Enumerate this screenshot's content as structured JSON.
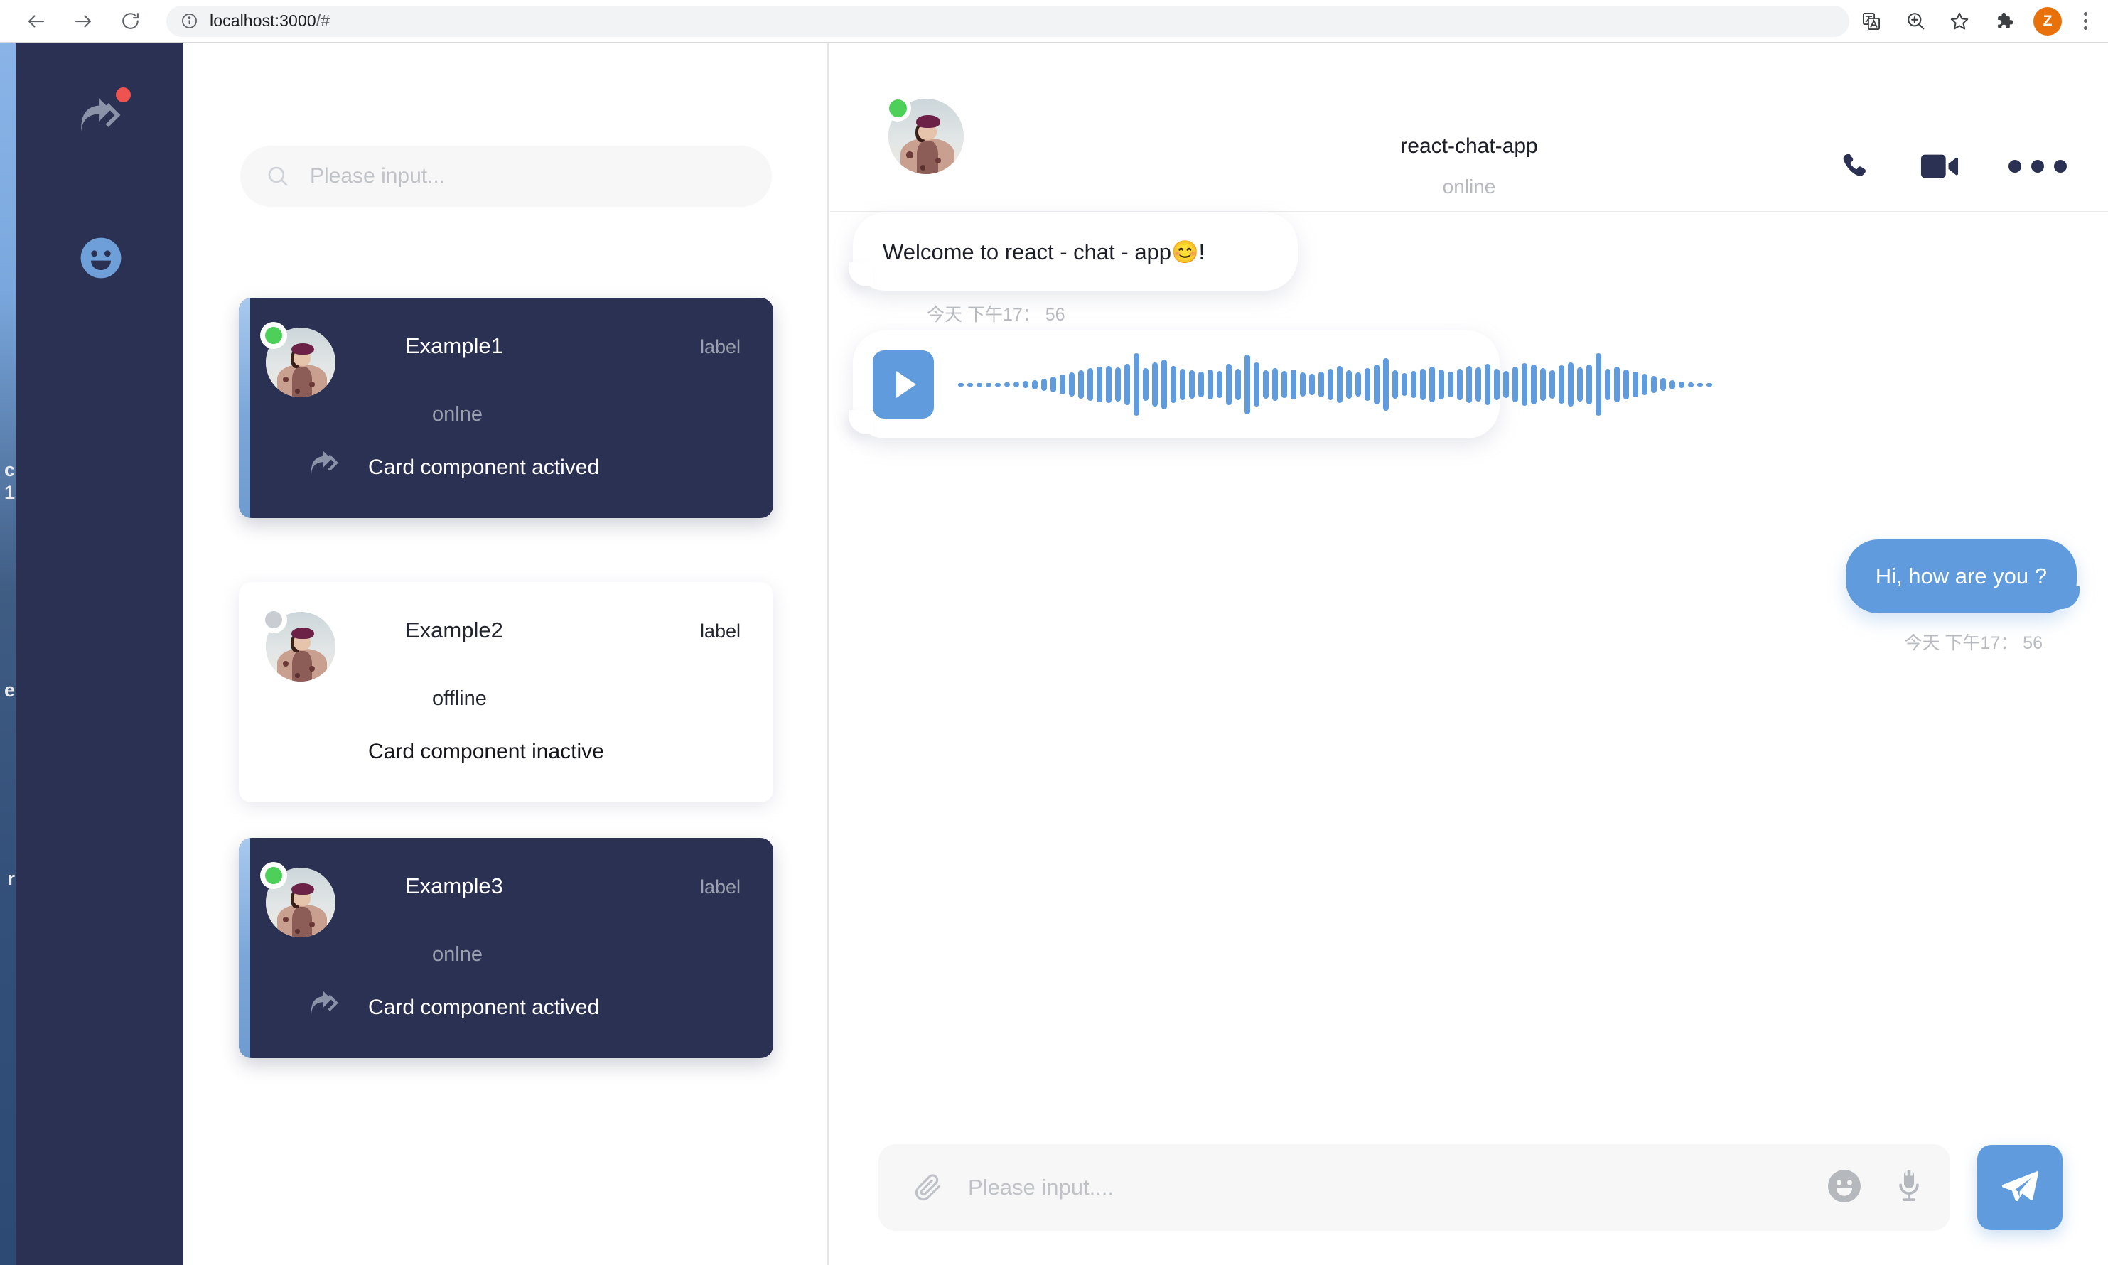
{
  "browser": {
    "url_main": "localhost:3000",
    "url_path": "/#",
    "profile_initial": "Z",
    "icons": [
      "back-icon",
      "forward-icon",
      "reload-icon",
      "page-info-icon",
      "translate-icon",
      "zoom-icon",
      "bookmark-star-icon",
      "extensions-puzzle-icon",
      "profile-avatar",
      "browser-menu-icon"
    ]
  },
  "bleed": {
    "fragments": [
      "c",
      "1",
      "e",
      "r"
    ]
  },
  "rail": {
    "items": [
      {
        "name": "forward-arrow-icon",
        "badge": true
      },
      {
        "name": "smiley-face-icon",
        "badge": false
      }
    ]
  },
  "search": {
    "placeholder": "Please input...",
    "value": ""
  },
  "contacts": [
    {
      "name": "Example1",
      "label": "label",
      "status": "onlne",
      "message": "Card component actived",
      "state": "active",
      "presence": "online",
      "has_forward_icon": true
    },
    {
      "name": "Example2",
      "label": "label",
      "status": "offline",
      "message": "Card component inactive",
      "state": "inactive",
      "presence": "offline",
      "has_forward_icon": false
    },
    {
      "name": "Example3",
      "label": "label",
      "status": "onlne",
      "message": "Card component actived",
      "state": "active",
      "presence": "online",
      "has_forward_icon": true
    }
  ],
  "chat": {
    "title": "react-chat-app",
    "subtitle": "online",
    "presence": "online",
    "actions": [
      "phone-call-icon",
      "video-camera-icon",
      "more-options-icon"
    ],
    "messages": [
      {
        "id": "m1",
        "direction": "incoming",
        "type": "text",
        "text": "Welcome to react - chat - app😊!",
        "time": "今天  下午17： 56"
      },
      {
        "id": "m2",
        "direction": "incoming",
        "type": "voice",
        "play_label": "play-icon",
        "time": ""
      },
      {
        "id": "m3",
        "direction": "outgoing",
        "type": "text",
        "text": "Hi, how are you ?",
        "time": "今天  下午17： 56"
      }
    ],
    "composer": {
      "placeholder": "Please input....",
      "value": "",
      "attach_icon": "paperclip-icon",
      "emoji_icon": "smiley-face-icon",
      "mic_icon": "microphone-icon",
      "send_icon": "send-paper-plane-icon"
    }
  },
  "colors": {
    "accent_blue": "#5f9bdd",
    "dark_navy": "#2b3152",
    "online_green": "#4cd05a",
    "badge_red": "#ef5350",
    "muted_text": "#b7babf"
  }
}
